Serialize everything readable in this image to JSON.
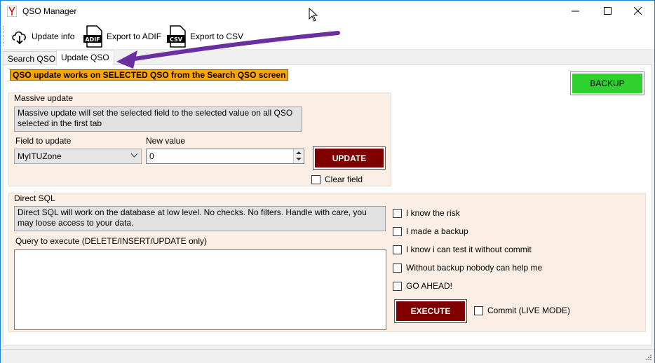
{
  "window": {
    "title": "QSO Manager"
  },
  "toolbar": {
    "items": [
      {
        "label": "Update info",
        "icon": "download-cloud-icon"
      },
      {
        "label": "Export to ADIF",
        "icon": "adif-file-icon",
        "badge": "ADIF"
      },
      {
        "label": "Export to CSV",
        "icon": "csv-file-icon",
        "badge": "CSV"
      }
    ]
  },
  "tabs": [
    {
      "label": "Search QSO",
      "active": false
    },
    {
      "label": "Update QSO",
      "active": true
    }
  ],
  "update_page": {
    "warning": "QSO update works on SELECTED QSO from the Search QSO screen",
    "backup_label": "BACKUP",
    "massive": {
      "title": "Massive update",
      "info": "Massive update will set the selected field to the selected value on all QSO selected in the first tab",
      "field_label": "Field to update",
      "field_value": "MyITUZone",
      "value_label": "New value",
      "value": "0",
      "update_label": "UPDATE",
      "clear_label": "Clear field"
    },
    "sql": {
      "title": "Direct SQL",
      "info": "Direct SQL will work on the database at low level. No checks. No filters. Handle with care, you may loose access to your data.",
      "query_label": "Query to execute (DELETE/INSERT/UPDATE only)",
      "query_value": "",
      "checks": [
        "I know the risk",
        "I made a backup",
        "I know i can test it without commit",
        "Without backup nobody can help me",
        "GO AHEAD!"
      ],
      "execute_label": "EXECUTE",
      "commit_label": "Commit (LIVE MODE)"
    }
  },
  "colors": {
    "warning_bg": "#ffa500",
    "backup_bg": "#2fd12f",
    "danger_bg": "#800000",
    "group_bg": "#fbeee4",
    "annotation_arrow": "#6a2fa0"
  }
}
